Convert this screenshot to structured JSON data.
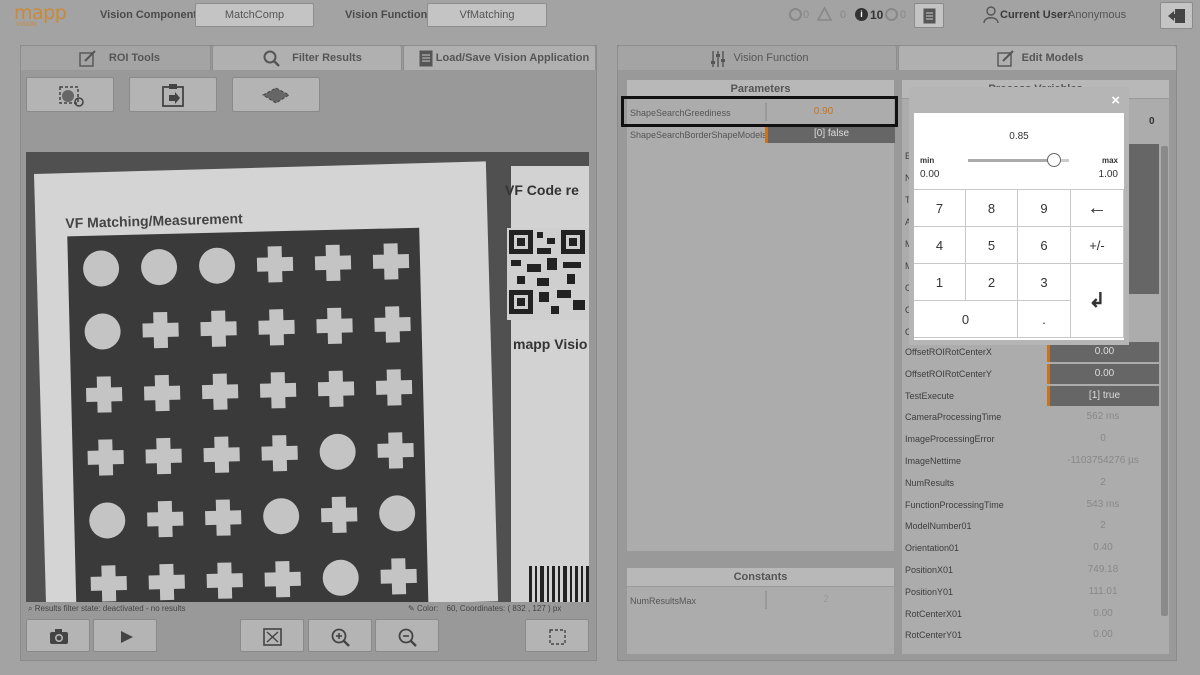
{
  "topbar": {
    "logo_text": "mapp",
    "logo_sub": "VISION",
    "vision_component_label": "Vision Component:",
    "vision_component_value": "MatchComp",
    "vision_function_label": "Vision Function:",
    "vision_function_value": "VfMatching",
    "error_count": "0",
    "warning_count": "0",
    "info_count": "10",
    "ok_count": "0",
    "user_label": "Current User:",
    "user_value": "Anonymous"
  },
  "left_tabs": [
    "ROI Tools",
    "Filter Results",
    "Load/Save Vision Application"
  ],
  "camera_image": {
    "heading": "VF Matching/Measurement",
    "side_heading": "VF Code re",
    "side_text": "mapp Visio",
    "grid": [
      [
        "c",
        "c",
        "c",
        "x",
        "x",
        "x"
      ],
      [
        "c",
        "x",
        "x",
        "x",
        "x",
        "x"
      ],
      [
        "x",
        "x",
        "x",
        "x",
        "x",
        "x"
      ],
      [
        "x",
        "x",
        "x",
        "x",
        "c",
        "x"
      ],
      [
        "c",
        "x",
        "x",
        "c",
        "x",
        "c"
      ],
      [
        "x",
        "x",
        "x",
        "x",
        "c",
        "x"
      ]
    ]
  },
  "status": {
    "filter_text": "Results filter state: deactivated - no results",
    "color_label": "Color:",
    "color_value": "60",
    "coords_label": ", Coordinates: (",
    "coord_x": "832",
    "coord_sep": ",",
    "coord_y": "127",
    "coord_unit": ") px"
  },
  "right_tabs": [
    "Vision Function",
    "Edit Models"
  ],
  "parameters": {
    "header": "Parameters",
    "rows": [
      {
        "name": "ShapeSearchGreediness",
        "value": "0.90"
      },
      {
        "name": "ShapeSearchBorderShapeModels",
        "value": "[0] false"
      }
    ]
  },
  "constants": {
    "header": "Constants",
    "rows": [
      {
        "name": "NumResultsMax",
        "value": "2"
      }
    ]
  },
  "process_variables": {
    "header": "Process Variables",
    "header_right": "lt",
    "header_right_value": "0",
    "partial_rows": [
      "E",
      "N",
      "T",
      "A",
      "M",
      "M",
      "O",
      "O",
      "O"
    ],
    "rows": [
      {
        "name": "OffsetROIRotCenterX",
        "value": "0.00",
        "dark": true
      },
      {
        "name": "OffsetROIRotCenterY",
        "value": "0.00",
        "dark": true
      },
      {
        "name": "TestExecute",
        "value": "[1] true",
        "dark": true
      },
      {
        "name": "CameraProcessingTime",
        "value": "562 ms",
        "dark": false
      },
      {
        "name": "ImageProcessingError",
        "value": "0",
        "dark": false
      },
      {
        "name": "ImageNettime",
        "value": "-1103754276 µs",
        "dark": false
      },
      {
        "name": "NumResults",
        "value": "2",
        "dark": false
      },
      {
        "name": "FunctionProcessingTime",
        "value": "543 ms",
        "dark": false
      },
      {
        "name": "ModelNumber01",
        "value": "2",
        "dark": false
      },
      {
        "name": "Orientation01",
        "value": "0.40",
        "dark": false
      },
      {
        "name": "PositionX01",
        "value": "749.18",
        "dark": false
      },
      {
        "name": "PositionY01",
        "value": "111.01",
        "dark": false
      },
      {
        "name": "RotCenterX01",
        "value": "0.00",
        "dark": false
      },
      {
        "name": "RotCenterY01",
        "value": "0.00",
        "dark": false
      }
    ]
  },
  "keypad": {
    "close": "×",
    "current_value": "0.85",
    "slider_fraction": 0.85,
    "min_label": "min",
    "min_value": "0.00",
    "max_label": "max",
    "max_value": "1.00",
    "keys": [
      "7",
      "8",
      "9",
      "←",
      "4",
      "5",
      "6",
      "+/-",
      "1",
      "2",
      "3",
      "↲",
      "0",
      "."
    ]
  },
  "colors": {
    "accent": "#c8741f"
  }
}
